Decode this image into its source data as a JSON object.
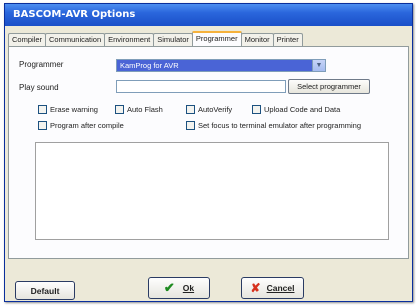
{
  "window": {
    "title": "BASCOM-AVR Options"
  },
  "tabs": [
    {
      "label": "Compiler",
      "active": false
    },
    {
      "label": "Communication",
      "active": false
    },
    {
      "label": "Environment",
      "active": false
    },
    {
      "label": "Simulator",
      "active": false
    },
    {
      "label": "Programmer",
      "active": true
    },
    {
      "label": "Monitor",
      "active": false
    },
    {
      "label": "Printer",
      "active": false
    }
  ],
  "programmer": {
    "programmer_label": "Programmer",
    "programmer_value": "KamProg for AVR",
    "play_sound_label": "Play sound",
    "play_sound_value": "",
    "select_button": "Select programmer",
    "checkboxes": {
      "erase_warning": "Erase warning",
      "auto_flash": "Auto Flash",
      "auto_verify": "AutoVerify",
      "upload_code": "Upload Code and Data",
      "program_after_compile": "Program after compile",
      "set_focus": "Set focus to terminal emulator after programming"
    }
  },
  "buttons": {
    "default": "Default",
    "ok": "Ok",
    "cancel": "Cancel"
  },
  "colors": {
    "titlebar": "#2a66dc",
    "selection": "#4a64d6",
    "accent_tab": "#f6b23c"
  }
}
